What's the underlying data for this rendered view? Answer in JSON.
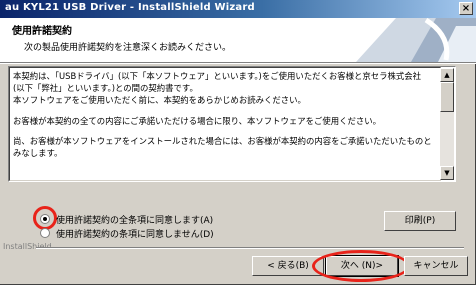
{
  "window": {
    "title": "au KYL21 USB Driver - InstallShield Wizard",
    "close_label": "×"
  },
  "header": {
    "title": "使用許諾契約",
    "subtitle": "次の製品使用許諾契約を注意深くお読みください。"
  },
  "license": {
    "lines": [
      "本契約は、「USBドライバ」(以下「本ソフトウェア」といいます。)をご使用いただくお客様と京セラ株式会社",
      "(以下「弊社」といいます。)との間の契約書です。",
      "本ソフトウェアをご使用いただく前に、本契約をあらかじめお読みください。",
      "",
      "お客様が本契約の全ての内容にご承諾いただける場合に限り、本ソフトウェアをご使用ください。",
      "",
      "尚、お客様が本ソフトウェアをインストールされた場合には、お客様が本契約の内容をご承諾いただいたものと",
      "みなします。"
    ],
    "scroll_up": "▲",
    "scroll_down": "▼"
  },
  "radios": {
    "accept": "使用許諾契約の全条項に同意します(A)",
    "decline": "使用許諾契約の条項に同意しません(D)",
    "selected": "accept"
  },
  "print_label": "印刷(P)",
  "installshield_label": "InstallShield",
  "buttons": {
    "back": "< 戻る(B)",
    "next": "次へ (N)>",
    "cancel": "キャンセル"
  },
  "annotation_color": "#e8231a"
}
